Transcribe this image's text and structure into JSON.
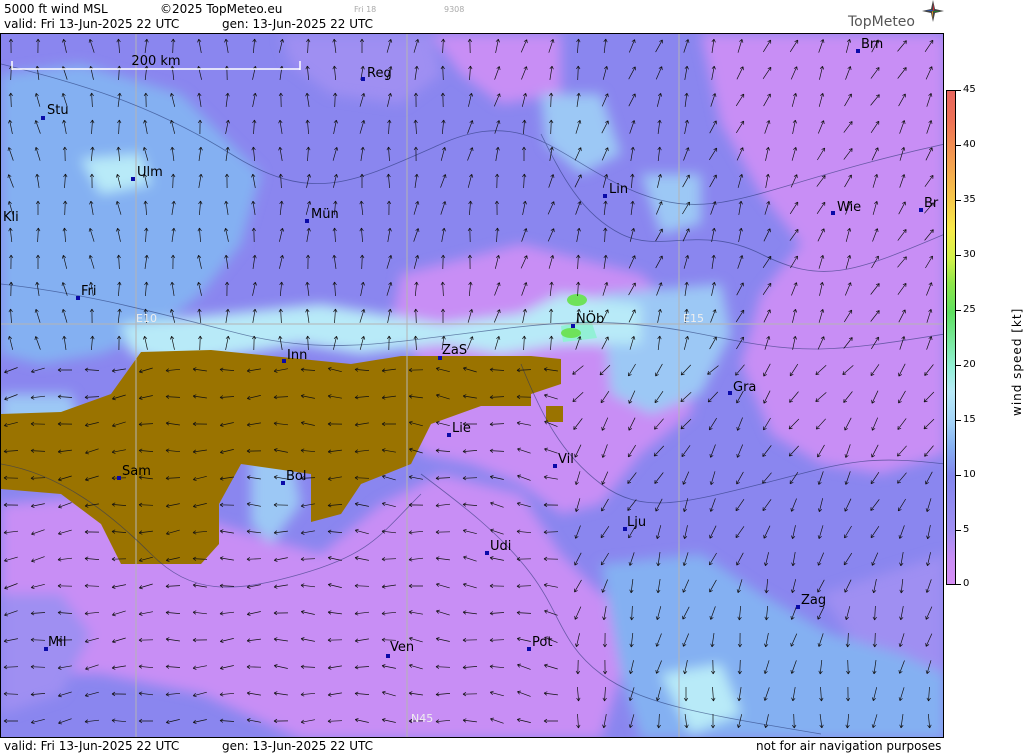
{
  "header": {
    "product": "5000 ft wind MSL",
    "copyright": "©2025 TopMeteo.eu",
    "valid": "valid:  Fri  13-Jun-2025  22 UTC",
    "generated": "gen: 13-Jun-2025 22 UTC",
    "faint_day": "Fri 18",
    "faint_code": "9308",
    "logo": "TopMeteo"
  },
  "scale_bar": {
    "label": "200 km"
  },
  "grid_labels": {
    "e10": "E10",
    "e15": "E15",
    "n45": "N45"
  },
  "cities": [
    {
      "name": "Stu"
    },
    {
      "name": "Ulm"
    },
    {
      "name": "Reg"
    },
    {
      "name": "Brn"
    },
    {
      "name": "Kli"
    },
    {
      "name": "Mün"
    },
    {
      "name": "Lin"
    },
    {
      "name": "Wie"
    },
    {
      "name": "Br"
    },
    {
      "name": "Fri"
    },
    {
      "name": "NÖb"
    },
    {
      "name": "Inn"
    },
    {
      "name": "ZaS"
    },
    {
      "name": "Gra"
    },
    {
      "name": "Lie"
    },
    {
      "name": "Sam"
    },
    {
      "name": "Bol"
    },
    {
      "name": "Vil"
    },
    {
      "name": "Lju"
    },
    {
      "name": "Udi"
    },
    {
      "name": "Zag"
    },
    {
      "name": "Mil"
    },
    {
      "name": "Pot"
    },
    {
      "name": "Ven"
    }
  ],
  "colorbar": {
    "label": "wind  speed  [kt]",
    "ticks": [
      "45",
      "40",
      "35",
      "30",
      "25",
      "20",
      "15",
      "10",
      "5",
      "0"
    ],
    "colors": {
      "0": "#d68ef5",
      "5": "#9f8ff2",
      "10": "#8286ee",
      "15": "#a4d4f8",
      "20": "#92f0d6",
      "25": "#5ee060",
      "30": "#d2f24a",
      "35": "#f8ea4a",
      "40": "#f49e50",
      "45": "#e8665e"
    }
  },
  "terrain_color": "#9a7300",
  "footer": {
    "valid": "valid:  Fri  13-Jun-2025  22 UTC",
    "generated": "gen: 13-Jun-2025 22 UTC",
    "disclaimer": "not for air navigation purposes"
  }
}
